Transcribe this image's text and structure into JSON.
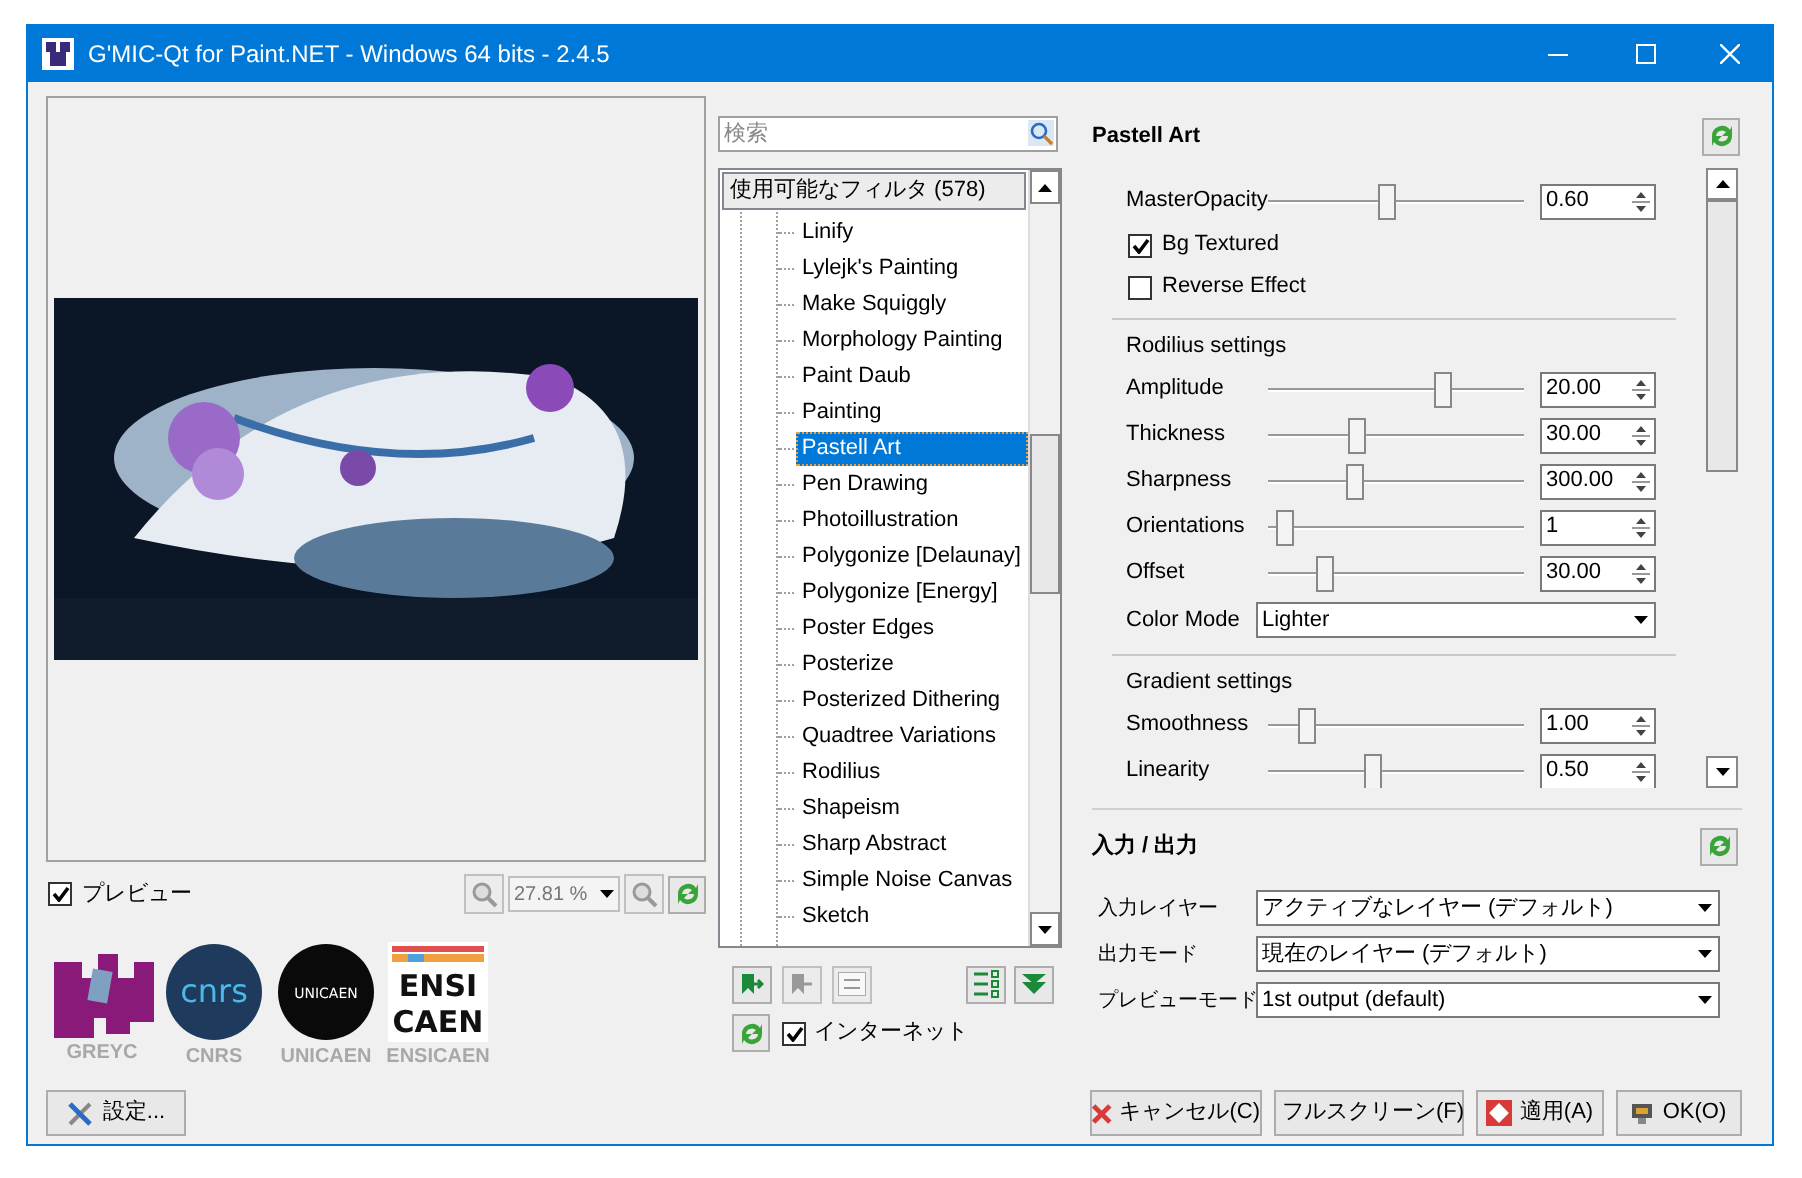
{
  "window": {
    "title": "G'MIC-Qt for Paint.NET - Windows 64 bits - 2.4.5"
  },
  "preview": {
    "kind": "picture",
    "checkbox": {
      "label": "プレビュー",
      "checked": true
    },
    "zoom": "27.81 %"
  },
  "logos": [
    {
      "kind": "greyc",
      "label": "GREYC"
    },
    {
      "kind": "cnrs",
      "mark": "cnrs",
      "label": "CNRS"
    },
    {
      "kind": "unicaen",
      "mark": "UNICAEN",
      "label": "UNICAEN"
    },
    {
      "kind": "ensicaen",
      "mark": "ENSI",
      "mark2": "CAEN",
      "label": "ENSICAEN"
    }
  ],
  "settings_button": "設定...",
  "filters": {
    "search_placeholder": "検索",
    "header": "使用可能なフィルタ (578)",
    "items": [
      {
        "label": "Linify",
        "selected": false
      },
      {
        "label": "Lylejk's Painting",
        "selected": false
      },
      {
        "label": "Make Squiggly",
        "selected": false
      },
      {
        "label": "Morphology Painting",
        "selected": false
      },
      {
        "label": "Paint Daub",
        "selected": false
      },
      {
        "label": "Painting",
        "selected": false
      },
      {
        "label": "Pastell Art",
        "selected": true
      },
      {
        "label": "Pen Drawing",
        "selected": false
      },
      {
        "label": "Photoillustration",
        "selected": false
      },
      {
        "label": "Polygonize [Delaunay]",
        "selected": false
      },
      {
        "label": "Polygonize [Energy]",
        "selected": false
      },
      {
        "label": "Poster Edges",
        "selected": false
      },
      {
        "label": "Posterize",
        "selected": false
      },
      {
        "label": "Posterized Dithering",
        "selected": false
      },
      {
        "label": "Quadtree Variations",
        "selected": false
      },
      {
        "label": "Rodilius",
        "selected": false
      },
      {
        "label": "Shapeism",
        "selected": false
      },
      {
        "label": "Sharp Abstract",
        "selected": false
      },
      {
        "label": "Simple Noise Canvas",
        "selected": false
      },
      {
        "label": "Sketch",
        "selected": false
      }
    ],
    "internet": {
      "label": "インターネット",
      "checked": true
    }
  },
  "filter_title": "Pastell Art",
  "params": [
    {
      "kind": "slider",
      "label": "MasterOpacity",
      "level": 0.44,
      "value": "0.60"
    },
    {
      "kind": "checkbox",
      "label": "Bg Textured",
      "checked": true
    },
    {
      "kind": "checkbox",
      "label": "Reverse Effect",
      "checked": false
    },
    {
      "kind": "separator"
    },
    {
      "kind": "heading",
      "label": "Rodilius settings"
    },
    {
      "kind": "slider",
      "label": "Amplitude",
      "level": 0.66,
      "value": "20.00"
    },
    {
      "kind": "slider",
      "label": "Thickness",
      "level": 0.32,
      "value": "30.00"
    },
    {
      "kind": "slider",
      "label": "Sharpness",
      "level": 0.31,
      "value": "300.00"
    },
    {
      "kind": "slider",
      "label": "Orientations",
      "level": 0.03,
      "value": "1"
    },
    {
      "kind": "slider",
      "label": "Offset",
      "level": 0.19,
      "value": "30.00"
    },
    {
      "kind": "select",
      "label": "Color Mode",
      "value": "Lighter"
    },
    {
      "kind": "separator"
    },
    {
      "kind": "heading",
      "label": "Gradient settings"
    },
    {
      "kind": "slider",
      "label": "Smoothness",
      "level": 0.12,
      "value": "1.00"
    },
    {
      "kind": "slider",
      "label": "Linearity",
      "level": 0.38,
      "value": "0.50"
    }
  ],
  "io": {
    "title": "入力 / 出力",
    "fields": [
      {
        "label": "入力レイヤー",
        "value": "アクティブなレイヤー (デフォルト)"
      },
      {
        "label": "出力モード",
        "value": "現在のレイヤー (デフォルト)"
      },
      {
        "label": "プレビューモード",
        "value": "1st output (default)"
      }
    ]
  },
  "buttons": [
    {
      "kind": "cancel",
      "label": "キャンセル(C)"
    },
    {
      "kind": "fullscreen",
      "label": "フルスクリーン(F)"
    },
    {
      "kind": "apply",
      "label": "適用(A)"
    },
    {
      "kind": "ok",
      "label": "OK(O)"
    }
  ]
}
